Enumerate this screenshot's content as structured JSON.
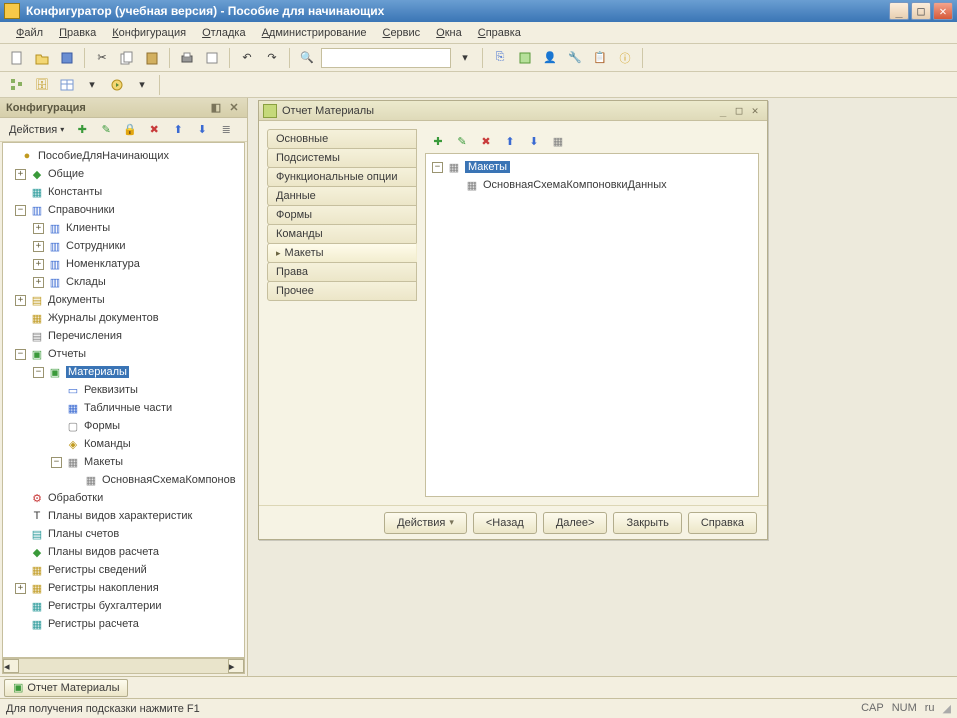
{
  "window": {
    "title": "Конфигуратор (учебная версия) - Пособие для начинающих"
  },
  "menubar": {
    "items": [
      "Файл",
      "Правка",
      "Конфигурация",
      "Отладка",
      "Администрирование",
      "Сервис",
      "Окна",
      "Справка"
    ]
  },
  "sidebar": {
    "title": "Конфигурация",
    "actions_label": "Действия",
    "root": "ПособиеДляНачинающих",
    "nodes": {
      "common": "Общие",
      "constants": "Константы",
      "catalogs": "Справочники",
      "clients": "Клиенты",
      "employees": "Сотрудники",
      "nomenclature": "Номенклатура",
      "warehouses": "Склады",
      "documents": "Документы",
      "docjournals": "Журналы документов",
      "enums": "Перечисления",
      "reports": "Отчеты",
      "materials": "Материалы",
      "attributes": "Реквизиты",
      "tabular": "Табличные части",
      "forms": "Формы",
      "commands": "Команды",
      "templates": "Макеты",
      "main_schema": "ОсновнаяСхемаКомпонов",
      "processors": "Обработки",
      "char_types": "Планы видов характеристик",
      "acc_plans": "Планы счетов",
      "calc_types": "Планы видов расчета",
      "info_reg": "Регистры сведений",
      "accum_reg": "Регистры накопления",
      "accounting_reg": "Регистры бухгалтерии",
      "calc_reg": "Регистры расчета"
    }
  },
  "dialog": {
    "title": "Отчет Материалы",
    "vtabs": [
      "Основные",
      "Подсистемы",
      "Функциональные опции",
      "Данные",
      "Формы",
      "Команды",
      "Макеты",
      "Права",
      "Прочее"
    ],
    "active_tab_index": 6,
    "tree_root": "Макеты",
    "tree_child": "ОсновнаяСхемаКомпоновкиДанных",
    "footer": {
      "actions": "Действия",
      "back": "<Назад",
      "next": "Далее>",
      "close": "Закрыть",
      "help": "Справка"
    }
  },
  "taskbar": {
    "tab": "Отчет Материалы"
  },
  "statusbar": {
    "hint": "Для получения подсказки нажмите F1",
    "cap": "CAP",
    "num": "NUM",
    "lang": "ru"
  }
}
